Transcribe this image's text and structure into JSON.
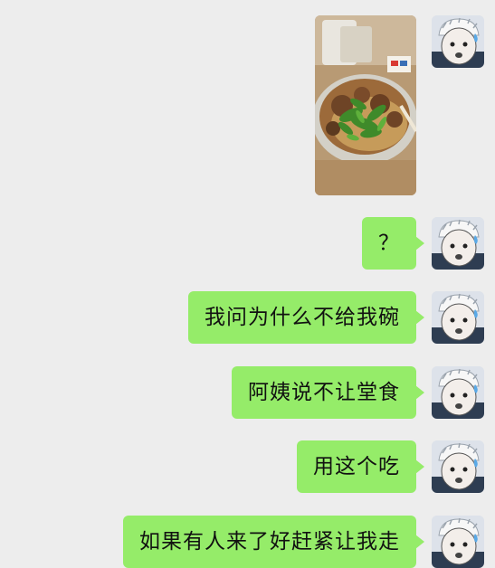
{
  "messages": [
    {
      "type": "image",
      "description": "food-photo"
    },
    {
      "type": "text",
      "text": "？"
    },
    {
      "type": "text",
      "text": "我问为什么不给我碗"
    },
    {
      "type": "text",
      "text": "阿姨说不让堂食"
    },
    {
      "type": "text",
      "text": "用这个吃"
    },
    {
      "type": "text",
      "text": "如果有人来了好赶紧让我走"
    }
  ],
  "colors": {
    "background": "#ededed",
    "sent_bubble": "#95ec69"
  }
}
